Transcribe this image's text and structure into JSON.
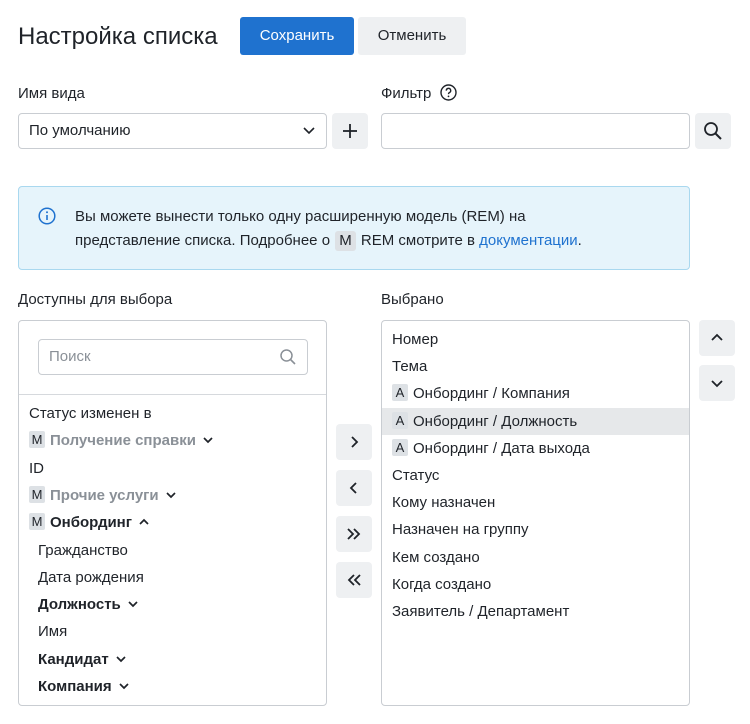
{
  "header": {
    "title": "Настройка списка",
    "save_label": "Сохранить",
    "cancel_label": "Отменить"
  },
  "view": {
    "label": "Имя вида",
    "selected": "По умолчанию"
  },
  "filter": {
    "label": "Фильтр",
    "value": ""
  },
  "info": {
    "line1": "Вы можете вынести только одну расширенную модель (REM) на",
    "line2_prefix": "представление списка. Подробнее о",
    "badge": "M",
    "line2_suffix": "REM смотрите в",
    "link": "документации",
    "end": "."
  },
  "available": {
    "label": "Доступны для выбора",
    "search_placeholder": "Поиск",
    "items": [
      {
        "text": "Статус изменен в",
        "tag": "",
        "style": "normal",
        "caret": ""
      },
      {
        "text": "Получение справки",
        "tag": "M",
        "style": "gray",
        "caret": "down"
      },
      {
        "text": "ID",
        "tag": "",
        "style": "normal",
        "caret": ""
      },
      {
        "text": "Прочие услуги",
        "tag": "M",
        "style": "gray",
        "caret": "down"
      },
      {
        "text": "Онбординг",
        "tag": "M",
        "style": "bold",
        "caret": "up"
      },
      {
        "text": "Гражданство",
        "tag": "",
        "style": "indent",
        "caret": ""
      },
      {
        "text": "Дата рождения",
        "tag": "",
        "style": "indent",
        "caret": ""
      },
      {
        "text": "Должность",
        "tag": "",
        "style": "indent-bold",
        "caret": "down"
      },
      {
        "text": "Имя",
        "tag": "",
        "style": "indent",
        "caret": ""
      },
      {
        "text": "Кандидат",
        "tag": "",
        "style": "indent-bold",
        "caret": "down"
      },
      {
        "text": "Компания",
        "tag": "",
        "style": "indent-bold",
        "caret": "down"
      }
    ]
  },
  "selected": {
    "label": "Выбрано",
    "items": [
      {
        "text": "Номер",
        "tag": "",
        "selected": false
      },
      {
        "text": "Тема",
        "tag": "",
        "selected": false
      },
      {
        "text": "Онбординг / Компания",
        "tag": "A",
        "selected": false
      },
      {
        "text": "Онбординг / Должность",
        "tag": "A",
        "selected": true
      },
      {
        "text": "Онбординг / Дата выхода",
        "tag": "A",
        "selected": false
      },
      {
        "text": "Статус",
        "tag": "",
        "selected": false
      },
      {
        "text": "Кому назначен",
        "tag": "",
        "selected": false
      },
      {
        "text": "Назначен на группу",
        "tag": "",
        "selected": false
      },
      {
        "text": "Кем создано",
        "tag": "",
        "selected": false
      },
      {
        "text": "Когда создано",
        "tag": "",
        "selected": false
      },
      {
        "text": "Заявитель / Департамент",
        "tag": "",
        "selected": false
      }
    ]
  },
  "colors": {
    "primary": "#1f72cf",
    "info_bg": "#e6f4fb",
    "info_border": "#a9d8ef",
    "muted_text": "#8a9097"
  }
}
